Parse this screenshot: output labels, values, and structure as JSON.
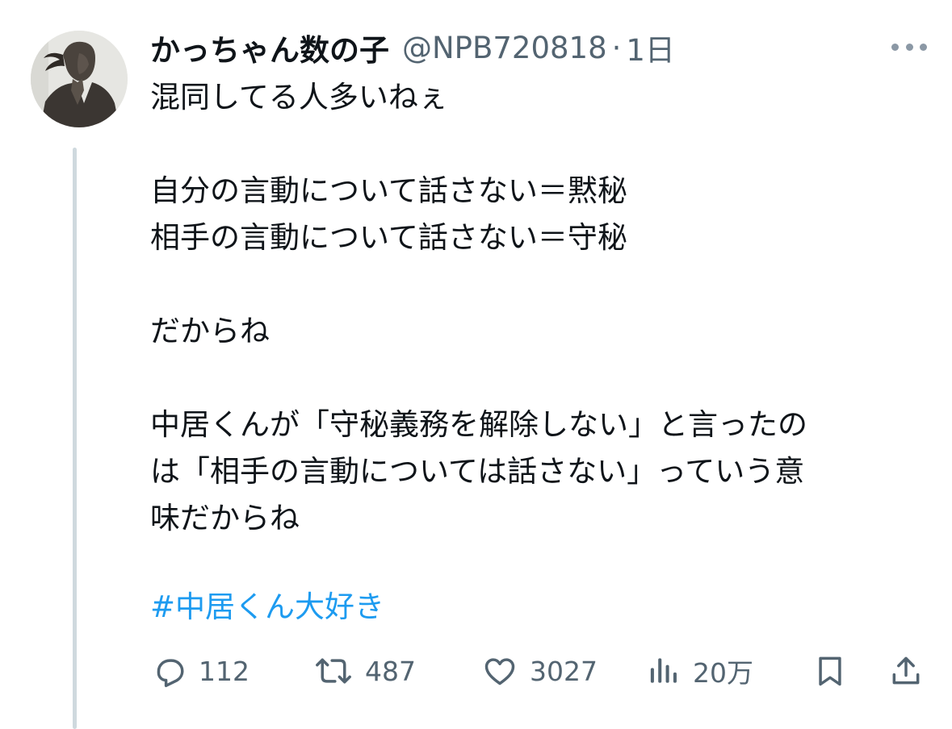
{
  "tweet": {
    "author": {
      "display_name": "かっちゃん数の子",
      "handle": "@NPB720818",
      "separator": "·",
      "time": "1日",
      "avatar": "bronze-statue-portrait"
    },
    "text_lines": [
      "混同してる人多いねぇ",
      "",
      "自分の言動について話さない＝黙秘",
      "相手の言動について話さない＝守秘",
      "",
      "だからね",
      "",
      "中居くんが「守秘義務を解除しない」と言ったの",
      "は「相手の言動については話さない」っていう意",
      "味だからね"
    ],
    "hashtag": "#中居くん大好き",
    "actions": {
      "reply": {
        "icon": "reply-icon",
        "count": "112"
      },
      "retweet": {
        "icon": "retweet-icon",
        "count": "487"
      },
      "like": {
        "icon": "heart-icon",
        "count": "3027"
      },
      "views": {
        "icon": "views-chart-icon",
        "count": "20万"
      },
      "bookmark": {
        "icon": "bookmark-icon"
      },
      "share": {
        "icon": "share-icon"
      }
    }
  },
  "colors": {
    "text": "#0f1419",
    "secondary_text": "#536471",
    "link": "#1d9bf0",
    "thread_line": "#cfd9de",
    "background": "#ffffff"
  }
}
